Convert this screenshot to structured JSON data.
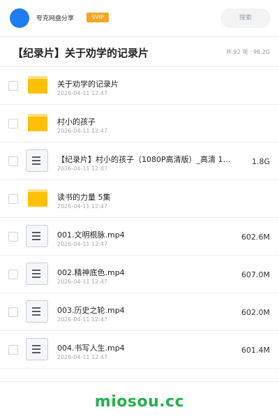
{
  "header": {
    "brand": "夸克网盘分享",
    "badge": "SVIP",
    "search_placeholder": "搜索",
    "colors": {
      "avatar": "#1f7cf2",
      "badge": "#f5a623"
    }
  },
  "folder": {
    "title": "【纪录片】关于劝学的记录片",
    "meta": "共 92 项 · 96.2G"
  },
  "files": [
    {
      "type": "folder",
      "icon": "folder-icon",
      "name": "关于劝学的记录片",
      "date": "2026-04-11 12:47",
      "size": ""
    },
    {
      "type": "folder",
      "icon": "folder-icon",
      "name": "村小的孩子",
      "date": "2026-04-11 12:47",
      "size": ""
    },
    {
      "type": "file",
      "icon": "document-icon",
      "name": "【纪录片】村小的孩子（1080P高清版）_高清 1…",
      "date": "2026-04-11 12:47",
      "size": "1.8G"
    },
    {
      "type": "folder",
      "icon": "folder-icon",
      "name": "读书的力量 5集",
      "date": "2026-04-11 12:47",
      "size": ""
    },
    {
      "type": "file",
      "icon": "document-icon",
      "name": "001.文明根脉.mp4",
      "date": "2026-04-11 12:47",
      "size": "602.6M"
    },
    {
      "type": "file",
      "icon": "document-icon",
      "name": "002.精神底色.mp4",
      "date": "2026-04-11 12:47",
      "size": "607.0M"
    },
    {
      "type": "file",
      "icon": "document-icon",
      "name": "003.历史之轮.mp4",
      "date": "2026-04-11 12:47",
      "size": "602.0M"
    },
    {
      "type": "file",
      "icon": "document-icon",
      "name": "004.书写人生.mp4",
      "date": "2026-04-11 12:47",
      "size": "601.4M"
    }
  ],
  "watermark": "miosou.cc"
}
